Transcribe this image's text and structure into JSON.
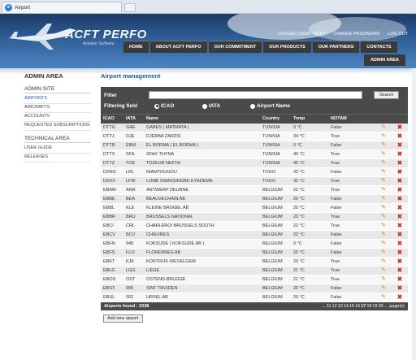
{
  "window": {
    "tab_title": "Airport",
    "ie_glyph": "e"
  },
  "header": {
    "logo": "ACFT PERFO",
    "logo_sub": "Aviation Software",
    "top_links": [
      "LOGGED USER : ACFT",
      "CHANGE PASSWORD",
      "LOG OUT"
    ],
    "nav": [
      "HOME",
      "ABOUT ACFT PERFO",
      "OUR COMMITMENT",
      "OUR PRODUCTS",
      "OUR PARTNERS",
      "CONTACTS"
    ],
    "subnav": "ADMIN AREA"
  },
  "sidebar": {
    "title": "ADMIN AREA",
    "admin_site": "ADMIN SITE",
    "admin_items": [
      "AIRPORTS",
      "AIRCRAFTS",
      "ACCOUNTS",
      "REQUESTED SUBSCRIPTIONS"
    ],
    "tech_area": "TECHNICAL AREA",
    "tech_items": [
      "USER GUIDE",
      "RELEASES"
    ]
  },
  "main": {
    "title": "Airport management",
    "filter_label": "Filter",
    "filter_value": "",
    "search_label": "Search",
    "filtering_field_label": "Filtering field",
    "radio_options": [
      "ICAO",
      "IATA",
      "Airport Name"
    ],
    "radio_selected": "ICAO",
    "columns": [
      "ICAO",
      "IATA",
      "Name",
      "Country",
      "Temp",
      "NOTAM"
    ],
    "rows": [
      [
        "DTTG",
        "GAE",
        "GABES ( MATMATA )",
        "TUNISIA",
        "0 °C",
        "False"
      ],
      [
        "DTTJ",
        "DJE",
        "DJERBA ZARZIS",
        "TUNISIA",
        "34 °C",
        "True"
      ],
      [
        "DTTR",
        "EBM",
        "EL BORMA ( EL BORMA )",
        "TUNISIA",
        "0 °C",
        "False"
      ],
      [
        "DTTX",
        "SFA",
        "SFAX THYNA",
        "TUNISIA",
        "40 °C",
        "True"
      ],
      [
        "DTTZ",
        "TOE",
        "TOZEUR NEFTA",
        "TUNISIA",
        "40 °C",
        "True"
      ],
      [
        "DXNG",
        "LRL",
        "NIAMTOUGOU",
        "TOGO",
        "32 °C",
        "False"
      ],
      [
        "DXXX",
        "LFW",
        "LOME GNASSINGBE EYADEMA",
        "TOGO",
        "32 °C",
        "True"
      ],
      [
        "EBAW",
        "ANR",
        "ANTWERP DEURNE",
        "BELGIUM",
        "22 °C",
        "True"
      ],
      [
        "EBBE",
        "BEA",
        "BEAUVECHAIN AB",
        "BELGIUM",
        "20 °C",
        "False"
      ],
      [
        "EBBL",
        "KLE",
        "KLEINE BROGEL AB",
        "BELGIUM",
        "20 °C",
        "False"
      ],
      [
        "EBBR",
        "BRU",
        "BRUSSELS NATIONAL",
        "BELGIUM",
        "23 °C",
        "True"
      ],
      [
        "EBCI",
        "CRL",
        "CHARLEROI BRUSSELS SOUTH",
        "BELGIUM",
        "22 °C",
        "True"
      ],
      [
        "EBCV",
        "BCV",
        "CHIEVRES",
        "BELGIUM",
        "22 °C",
        "False"
      ],
      [
        "EBFN",
        "948",
        "KOKSIJDE ( KOKSIJDE AB )",
        "BELGIUM",
        "0 °C",
        "False"
      ],
      [
        "EBFS",
        "FLO",
        "FLORENNES AB",
        "BELGIUM",
        "20 °C",
        "False"
      ],
      [
        "EBKT",
        "KJK",
        "KORTRIJK-WEVELGEM",
        "BELGIUM",
        "20 °C",
        "True"
      ],
      [
        "EBLG",
        "LGG",
        "LIEGE",
        "BELGIUM",
        "21 °C",
        "True"
      ],
      [
        "EBOS",
        "OST",
        "OSTEND-BRUGGE",
        "BELGIUM",
        "21 °C",
        "True"
      ],
      [
        "EBST",
        "005",
        "SINT TRUIDEN",
        "BELGIUM",
        "20 °C",
        "False"
      ],
      [
        "EBUL",
        "002",
        "URSEL AB",
        "BELGIUM",
        "20 °C",
        "False"
      ]
    ],
    "footer_count": "Airports found : 3338",
    "pages": [
      "...",
      "11",
      "12",
      "13",
      "14",
      "15",
      "16",
      "17",
      "18",
      "19",
      "20",
      "..."
    ],
    "current_page": "17",
    "pages_suffix": "page(s)",
    "add_button": "Add new airport",
    "icons": {
      "edit": "pencil-icon",
      "delete": "delete-icon"
    }
  },
  "colors": {
    "accent": "#1e5aa8",
    "dark": "#4a4a4a",
    "delete": "#d52121",
    "edit": "#d08a12"
  }
}
